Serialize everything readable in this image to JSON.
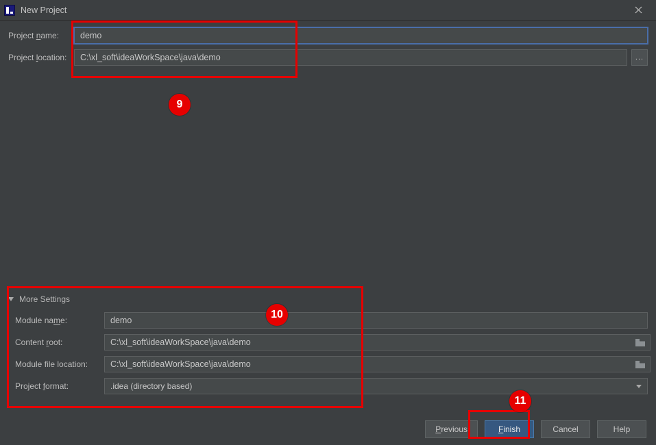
{
  "window": {
    "title": "New Project"
  },
  "fields": {
    "project_name_label_pre": "Project ",
    "project_name_label_u": "n",
    "project_name_label_post": "ame:",
    "project_name_value": "demo",
    "project_location_label_pre": "Project ",
    "project_location_label_u": "l",
    "project_location_label_post": "ocation:",
    "project_location_value": "C:\\xl_soft\\ideaWorkSpace\\java\\demo",
    "browse_label": "..."
  },
  "more": {
    "header": "More Settings",
    "module_name_label_pre": "Module na",
    "module_name_label_u": "m",
    "module_name_label_post": "e:",
    "module_name_value": "demo",
    "content_root_label_pre": "Content ",
    "content_root_label_u": "r",
    "content_root_label_post": "oot:",
    "content_root_value": "C:\\xl_soft\\ideaWorkSpace\\java\\demo",
    "module_file_loc_label": "Module file location:",
    "module_file_loc_value": "C:\\xl_soft\\ideaWorkSpace\\java\\demo",
    "project_format_label_pre": "Project ",
    "project_format_label_u": "f",
    "project_format_label_post": "ormat:",
    "project_format_value": ".idea (directory based)"
  },
  "buttons": {
    "previous_u": "P",
    "previous_post": "revious",
    "finish_u": "F",
    "finish_post": "inish",
    "cancel": "Cancel",
    "help": "Help"
  },
  "annotations": {
    "a9": "9",
    "a10": "10",
    "a11": "11"
  }
}
